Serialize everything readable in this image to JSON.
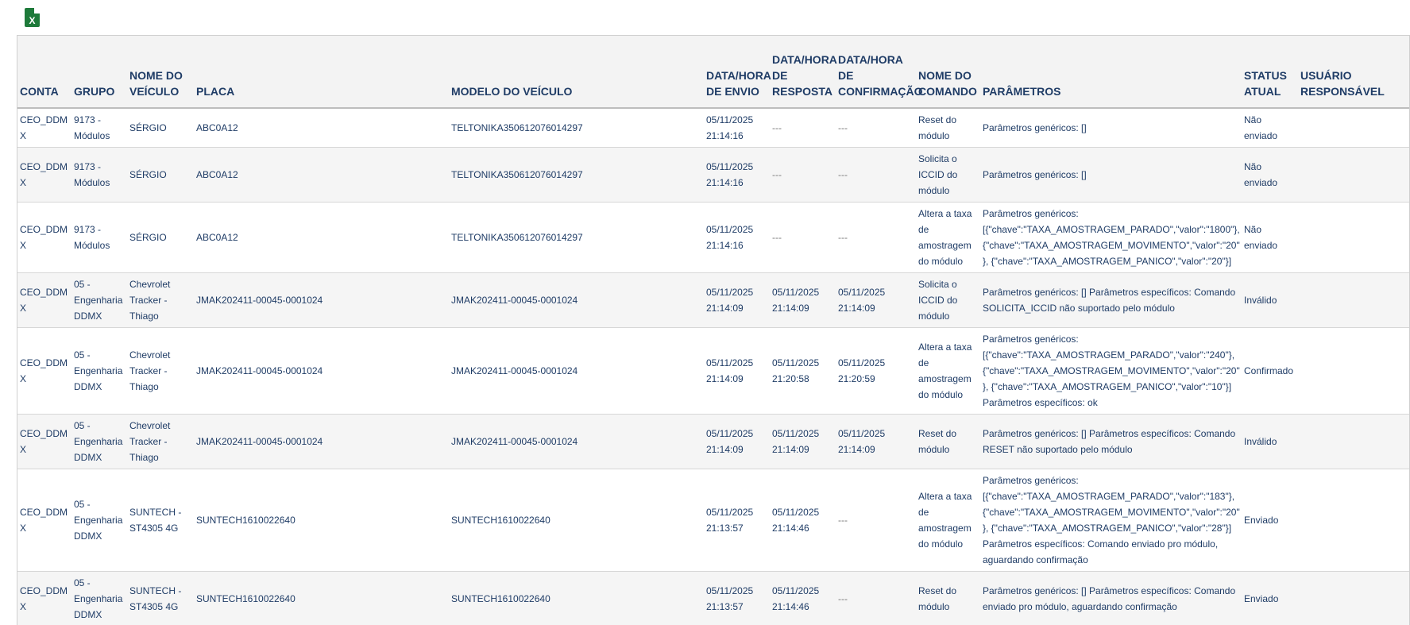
{
  "toolbar": {
    "export_icon": "excel-export-icon",
    "export_glyph": "X"
  },
  "table": {
    "headers": {
      "conta": "CONTA",
      "grupo": "GRUPO",
      "nome_veiculo": "NOME DO VEÍCULO",
      "placa": "PLACA",
      "modelo": "MODELO DO VEÍCULO",
      "envio": "DATA/HORA DE ENVIO",
      "resposta": "DATA/HORA DE RESPOSTA",
      "confirmacao": "DATA/HORA DE CONFIRMAÇÃO",
      "comando": "NOME DO COMANDO",
      "parametros": "PARÂMETROS",
      "status": "STATUS ATUAL",
      "usuario": "USUÁRIO RESPONSÁVEL"
    },
    "rows": [
      {
        "conta": "CEO_DDMX",
        "grupo": "9173 - Módulos",
        "nome_veiculo": "SÉRGIO",
        "placa": "ABC0A12",
        "modelo": "TELTONIKA350612076014297",
        "envio": "05/11/2025 21:14:16",
        "resposta": "---",
        "confirmacao": "---",
        "comando": "Reset do módulo",
        "parametros": "Parâmetros genéricos: []",
        "status": "Não enviado",
        "usuario": ""
      },
      {
        "conta": "CEO_DDMX",
        "grupo": "9173 - Módulos",
        "nome_veiculo": "SÉRGIO",
        "placa": "ABC0A12",
        "modelo": "TELTONIKA350612076014297",
        "envio": "05/11/2025 21:14:16",
        "resposta": "---",
        "confirmacao": "---",
        "comando": "Solicita o ICCID do módulo",
        "parametros": "Parâmetros genéricos: []",
        "status": "Não enviado",
        "usuario": ""
      },
      {
        "conta": "CEO_DDMX",
        "grupo": "9173 - Módulos",
        "nome_veiculo": "SÉRGIO",
        "placa": "ABC0A12",
        "modelo": "TELTONIKA350612076014297",
        "envio": "05/11/2025 21:14:16",
        "resposta": "---",
        "confirmacao": "---",
        "comando": "Altera a taxa de amostragem do módulo",
        "parametros": "Parâmetros genéricos: [{\"chave\":\"TAXA_AMOSTRAGEM_PARADO\",\"valor\":\"1800\"}, {\"chave\":\"TAXA_AMOSTRAGEM_MOVIMENTO\",\"valor\":\"20\"}, {\"chave\":\"TAXA_AMOSTRAGEM_PANICO\",\"valor\":\"20\"}]",
        "status": "Não enviado",
        "usuario": ""
      },
      {
        "conta": "CEO_DDMX",
        "grupo": "05 - Engenharia DDMX",
        "nome_veiculo": "Chevrolet Tracker - Thiago",
        "placa": "JMAK202411-00045-0001024",
        "modelo": "JMAK202411-00045-0001024",
        "envio": "05/11/2025 21:14:09",
        "resposta": "05/11/2025 21:14:09",
        "confirmacao": "05/11/2025 21:14:09",
        "comando": "Solicita o ICCID do módulo",
        "parametros": "Parâmetros genéricos: [] Parâmetros específicos: Comando SOLICITA_ICCID não suportado pelo módulo",
        "status": "Inválido",
        "usuario": ""
      },
      {
        "conta": "CEO_DDMX",
        "grupo": "05 - Engenharia DDMX",
        "nome_veiculo": "Chevrolet Tracker - Thiago",
        "placa": "JMAK202411-00045-0001024",
        "modelo": "JMAK202411-00045-0001024",
        "envio": "05/11/2025 21:14:09",
        "resposta": "05/11/2025 21:20:58",
        "confirmacao": "05/11/2025 21:20:59",
        "comando": "Altera a taxa de amostragem do módulo",
        "parametros": "Parâmetros genéricos: [{\"chave\":\"TAXA_AMOSTRAGEM_PARADO\",\"valor\":\"240\"}, {\"chave\":\"TAXA_AMOSTRAGEM_MOVIMENTO\",\"valor\":\"20\"}, {\"chave\":\"TAXA_AMOSTRAGEM_PANICO\",\"valor\":\"10\"}] Parâmetros específicos: ok",
        "status": "Confirmado",
        "usuario": ""
      },
      {
        "conta": "CEO_DDMX",
        "grupo": "05 - Engenharia DDMX",
        "nome_veiculo": "Chevrolet Tracker - Thiago",
        "placa": "JMAK202411-00045-0001024",
        "modelo": "JMAK202411-00045-0001024",
        "envio": "05/11/2025 21:14:09",
        "resposta": "05/11/2025 21:14:09",
        "confirmacao": "05/11/2025 21:14:09",
        "comando": "Reset do módulo",
        "parametros": "Parâmetros genéricos: [] Parâmetros específicos: Comando RESET não suportado pelo módulo",
        "status": "Inválido",
        "usuario": ""
      },
      {
        "conta": "CEO_DDMX",
        "grupo": "05 - Engenharia DDMX",
        "nome_veiculo": "SUNTECH - ST4305 4G",
        "placa": "SUNTECH1610022640",
        "modelo": "SUNTECH1610022640",
        "envio": "05/11/2025 21:13:57",
        "resposta": "05/11/2025 21:14:46",
        "confirmacao": "---",
        "comando": "Altera a taxa de amostragem do módulo",
        "parametros": "Parâmetros genéricos: [{\"chave\":\"TAXA_AMOSTRAGEM_PARADO\",\"valor\":\"183\"}, {\"chave\":\"TAXA_AMOSTRAGEM_MOVIMENTO\",\"valor\":\"20\"}, {\"chave\":\"TAXA_AMOSTRAGEM_PANICO\",\"valor\":\"28\"}] Parâmetros específicos: Comando enviado pro módulo, aguardando confirmação",
        "status": "Enviado",
        "usuario": ""
      },
      {
        "conta": "CEO_DDMX",
        "grupo": "05 - Engenharia DDMX",
        "nome_veiculo": "SUNTECH - ST4305 4G",
        "placa": "SUNTECH1610022640",
        "modelo": "SUNTECH1610022640",
        "envio": "05/11/2025 21:13:57",
        "resposta": "05/11/2025 21:14:46",
        "confirmacao": "---",
        "comando": "Reset do módulo",
        "parametros": "Parâmetros genéricos: [] Parâmetros específicos: Comando enviado pro módulo, aguardando confirmação",
        "status": "Enviado",
        "usuario": ""
      }
    ]
  }
}
